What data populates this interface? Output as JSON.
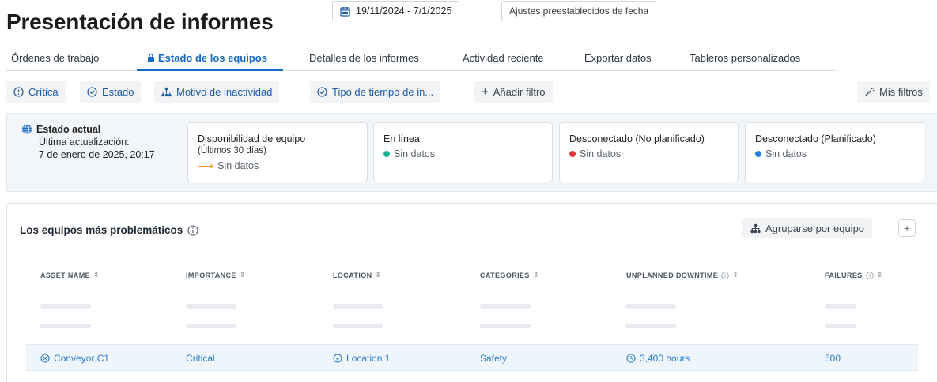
{
  "header": {
    "title": "Presentación de informes",
    "date_range": "19/11/2024 - 7/1/2025",
    "presets_label": "Ajustes preestablecidos de fecha"
  },
  "tabs": [
    {
      "label": "Órdenes de trabajo",
      "active": false
    },
    {
      "label": "Estado de los equipos",
      "active": true
    },
    {
      "label": "Detalles de los informes",
      "active": false
    },
    {
      "label": "Actividad reciente",
      "active": false
    },
    {
      "label": "Exportar datos",
      "active": false
    },
    {
      "label": "Tableros personalizados",
      "active": false
    }
  ],
  "filters": {
    "critical": "Crítica",
    "status": "Estado",
    "downtime_reason": "Motivo de inactividad",
    "downtime_type": "Tipo de tiempo de in...",
    "add_filter": "Añadir filtro",
    "my_filters": "Mis filtros"
  },
  "status": {
    "title": "Estado actual",
    "updated_label": "Última actualización:",
    "updated_value": "7 de enero de 2025, 20:17",
    "cards": [
      {
        "label": "Disponibilidad de equipo",
        "sublabel": "(Últimos 30 días)",
        "value": "Sin datos",
        "indicator": "arrow",
        "color": "#f09a26"
      },
      {
        "label": "En línea",
        "value": "Sin datos",
        "indicator": "dot",
        "color": "#1bb391"
      },
      {
        "label": "Desconectado (No planificado)",
        "value": "Sin datos",
        "indicator": "dot",
        "color": "#e03b3b"
      },
      {
        "label": "Desconectado (Planificado)",
        "value": "Sin datos",
        "indicator": "dot",
        "color": "#1f7fe0"
      }
    ]
  },
  "table": {
    "title": "Los equipos más problemáticos",
    "group_label": "Agruparse por equipo",
    "plus_label": "+",
    "columns": [
      "ASSET NAME",
      "IMPORTANCE",
      "LOCATION",
      "CATEGORIES",
      "UNPLANNED DOWNTIME",
      "FAILURES"
    ],
    "rows": [
      {
        "asset": "Conveyor C1",
        "importance": "Critical",
        "location": "Location 1",
        "category": "Safety",
        "downtime": "3,400 hours",
        "failures": "500"
      }
    ]
  },
  "colors": {
    "accent": "#1769c4",
    "link": "#2e7cc7"
  }
}
